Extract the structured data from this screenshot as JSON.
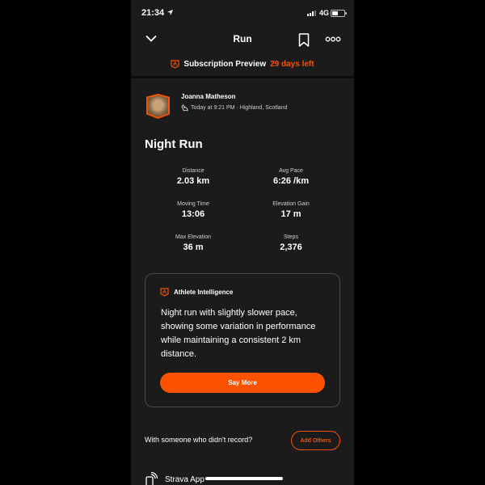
{
  "status_bar": {
    "time": "21:34",
    "network": "4G",
    "icons": [
      "location-arrow-icon",
      "signal-icon",
      "battery-icon"
    ]
  },
  "nav": {
    "title": "Run",
    "icons": [
      "chevron-down-icon",
      "bookmark-icon",
      "more-icon"
    ]
  },
  "subscription": {
    "label": "Subscription Preview",
    "days_left": "29 days left",
    "icon": "strava-badge-icon"
  },
  "athlete": {
    "name": "Joanna Matheson",
    "meta": "Today at 9:21 PM · Highland, Scotland",
    "meta_icon": "shoe-icon"
  },
  "activity": {
    "title": "Night Run",
    "stats": [
      {
        "label": "Distance",
        "value": "2.03 km"
      },
      {
        "label": "Avg Pace",
        "value": "6:26 /km"
      },
      {
        "label": "Moving Time",
        "value": "13:06"
      },
      {
        "label": "Elevation Gain",
        "value": "17 m"
      },
      {
        "label": "Max Elevation",
        "value": "36 m"
      },
      {
        "label": "Steps",
        "value": "2,376"
      }
    ]
  },
  "insight": {
    "title": "Athlete Intelligence",
    "text": "Night run with slightly slower pace, showing some variation in performance while maintaining a consistent 2 km distance.",
    "button": "Say More"
  },
  "companions": {
    "text": "With someone who didn't record?",
    "button": "Add Others"
  },
  "device": {
    "label": "Strava App"
  },
  "colors": {
    "accent": "#fc5200",
    "background": "#1b1b1b",
    "outer": "#000000"
  }
}
